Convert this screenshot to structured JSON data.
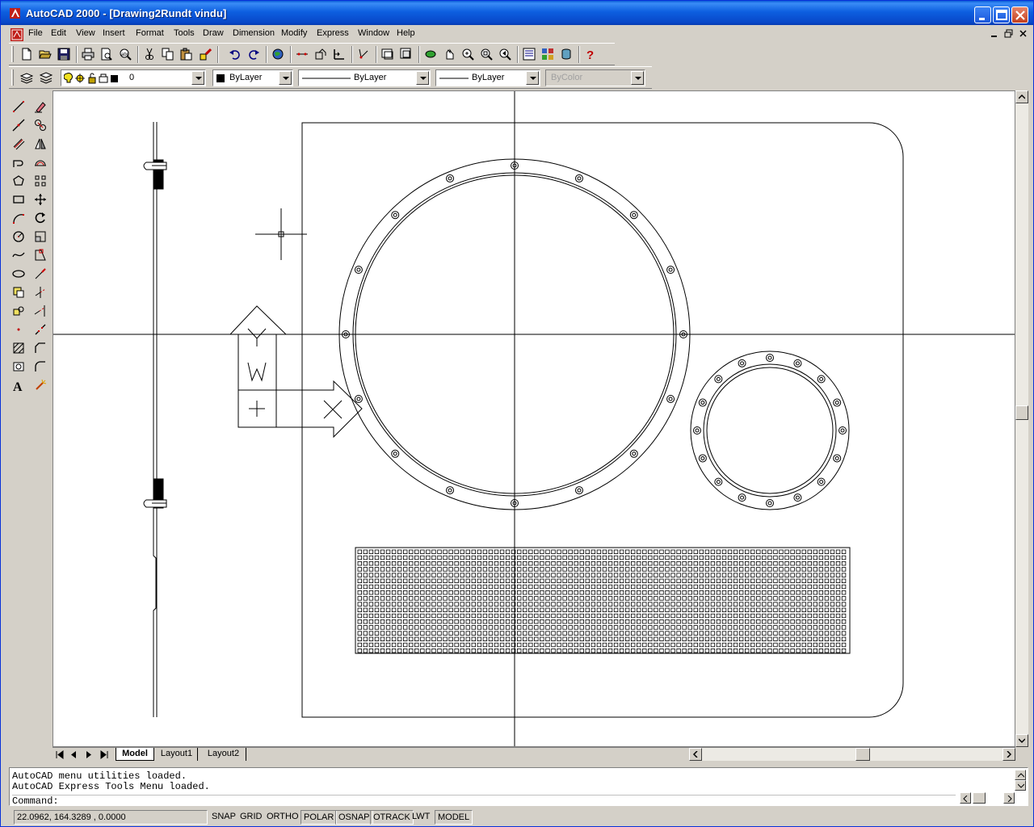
{
  "window": {
    "title": "AutoCAD 2000 - [Drawing2Rundt vindu]"
  },
  "menu": {
    "items": [
      "File",
      "Edit",
      "View",
      "Insert",
      "Format",
      "Tools",
      "Draw",
      "Dimension",
      "Modify",
      "Express",
      "Window",
      "Help"
    ]
  },
  "toolbars": {
    "standard": [
      "new-icon",
      "open-icon",
      "save-icon",
      "print-icon",
      "print-preview-icon",
      "spelling-icon",
      "cut-icon",
      "copy-icon",
      "paste-icon",
      "match-properties-icon",
      "undo-icon",
      "redo-icon",
      "web-icon",
      "hyperlink-icon",
      "object-snap-icon",
      "ucs-icon",
      "distance-icon",
      "aerial-view-icon",
      "pan-icon",
      "zoom-realtime-icon",
      "zoom-window-icon",
      "zoom-previous-icon",
      "properties-icon",
      "adcenter-icon",
      "dbconnect-icon",
      "help-icon"
    ],
    "layer_value": "0",
    "color_value": "ByLayer",
    "linetype_value": "ByLayer",
    "lineweight_value": "ByLayer",
    "plotstyle_value": "ByColor"
  },
  "draw_tools": [
    "line-icon",
    "construction-line-icon",
    "multiline-icon",
    "polyline-icon",
    "polygon-icon",
    "rectangle-icon",
    "arc-icon",
    "circle-icon",
    "spline-icon",
    "ellipse-icon",
    "insert-block-icon",
    "make-block-icon",
    "point-icon",
    "hatch-icon",
    "region-icon",
    "text-icon"
  ],
  "modify_tools": [
    "erase-icon",
    "copy-object-icon",
    "mirror-icon",
    "offset-icon",
    "array-icon",
    "move-icon",
    "rotate-icon",
    "scale-icon",
    "stretch-icon",
    "lengthen-icon",
    "trim-icon",
    "extend-icon",
    "break-icon",
    "chamfer-icon",
    "fillet-icon",
    "explode-icon"
  ],
  "tabs": {
    "model": "Model",
    "layout1": "Layout1",
    "layout2": "Layout2"
  },
  "command": {
    "line1": "AutoCAD menu utilities loaded.",
    "line2": "AutoCAD Express Tools Menu loaded.",
    "prompt": "Command:"
  },
  "status": {
    "coords": "22.0962,  164.3289 , 0.0000",
    "snap": "SNAP",
    "grid": "GRID",
    "ortho": "ORTHO",
    "polar": "POLAR",
    "osnap": "OSNAP",
    "otrack": "OTRACK",
    "lwt": "LWT",
    "model": "MODEL"
  },
  "colors": {
    "titlebar": "#0a5bd7",
    "chrome": "#d4d0c8",
    "canvas": "#ffffff",
    "drawing_lines": "#000000"
  }
}
